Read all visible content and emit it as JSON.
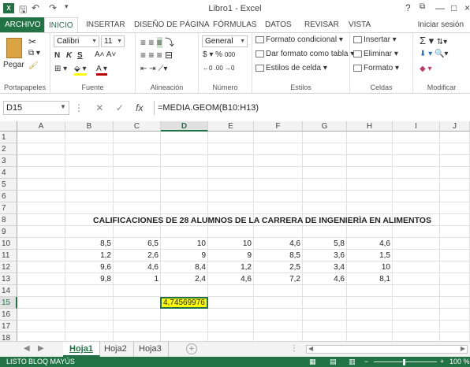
{
  "window": {
    "title": "Libro1 - Excel",
    "help": "?",
    "controls": [
      "—",
      "□",
      "×"
    ]
  },
  "ribbon_tabs": [
    {
      "label": "ARCHIVO"
    },
    {
      "label": "INICIO"
    },
    {
      "label": "INSERTAR"
    },
    {
      "label": "DISEÑO DE PÁGINA"
    },
    {
      "label": "FÓRMULAS"
    },
    {
      "label": "DATOS"
    },
    {
      "label": "REVISAR"
    },
    {
      "label": "VISTA"
    }
  ],
  "signin": "Iniciar sesión",
  "groups": {
    "clipboard": {
      "label": "Portapapeles",
      "paste": "Pegar"
    },
    "font": {
      "label": "Fuente",
      "name": "Calibri",
      "size": "11",
      "bold": "N",
      "italic": "K",
      "underline": "S"
    },
    "alignment": {
      "label": "Alineación"
    },
    "number": {
      "label": "Número",
      "format": "General",
      "currency": "$",
      "percent": "%",
      "thousands": "000"
    },
    "styles": {
      "label": "Estilos",
      "conditional": "Formato condicional",
      "table": "Dar formato como tabla",
      "cell": "Estilos de celda"
    },
    "cells": {
      "label": "Celdas",
      "insert": "Insertar",
      "delete": "Eliminar",
      "format": "Formato"
    },
    "editing": {
      "label": "Modificar"
    }
  },
  "formula_bar": {
    "name_box": "D15",
    "fx": "fx",
    "formula": "=MEDIA.GEOM(B10:H13)"
  },
  "columns": [
    "A",
    "B",
    "C",
    "D",
    "E",
    "F",
    "G",
    "H",
    "I",
    "J"
  ],
  "rows": [
    "1",
    "2",
    "3",
    "4",
    "5",
    "6",
    "7",
    "8",
    "9",
    "10",
    "11",
    "12",
    "13",
    "14",
    "15",
    "16",
    "17",
    "18"
  ],
  "heading": "CALIFICACIONES DE 28 ALUMNOS DE LA CARRERA DE INGENIERÌA EN ALIMENTOS",
  "table": [
    [
      "8,5",
      "6,5",
      "10",
      "10",
      "4,6",
      "5,8",
      "4,6"
    ],
    [
      "1,2",
      "2,6",
      "9",
      "9",
      "8,5",
      "3,6",
      "1,5"
    ],
    [
      "9,6",
      "4,6",
      "8,4",
      "1,2",
      "2,5",
      "3,4",
      "10"
    ],
    [
      "9,8",
      "1",
      "2,4",
      "4,6",
      "7,2",
      "4,6",
      "8,1"
    ]
  ],
  "active_cell": {
    "ref": "D15",
    "value": "4,74569976",
    "highlight": "#ffff00"
  },
  "sheets": [
    {
      "label": "Hoja1"
    },
    {
      "label": "Hoja2"
    },
    {
      "label": "Hoja3"
    }
  ],
  "status": {
    "mode": "LISTO",
    "caps": "BLOQ MAYÚS",
    "zoom": "100 %"
  },
  "colors": {
    "accent": "#217346"
  }
}
